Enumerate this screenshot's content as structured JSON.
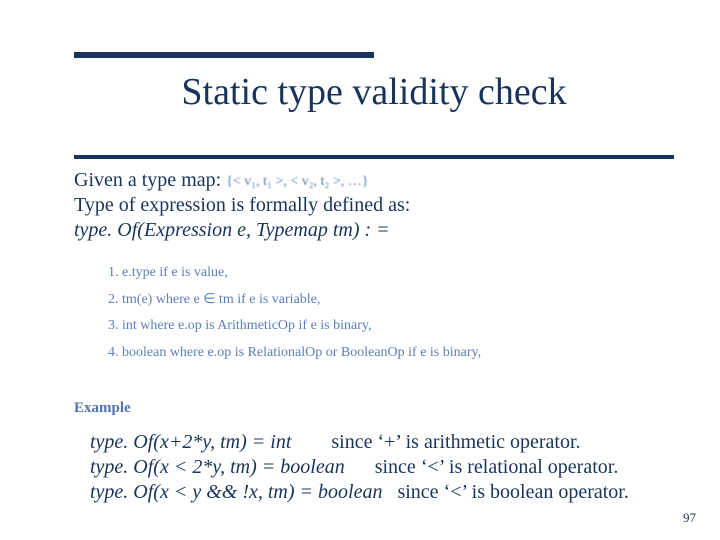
{
  "title": "Static type validity check",
  "intro": {
    "given_prefix": "Given a type map:",
    "typemap_set": "{< v₁, t₁ >, < v₂, t₂ >, …}",
    "line2": "Type of expression is formally defined as:",
    "line3": "type. Of(Expression e, Typemap tm)  : ="
  },
  "rules": {
    "r1": "1.  e.type if e is value,",
    "r2": "2.  tm(e) where e ∈ tm if e is variable,",
    "r3": "3.  int where e.op is ArithmeticOp if e is binary,",
    "r4": "4.  boolean where e.op is RelationalOp or BooleanOp if e is binary,"
  },
  "example_label": "Example",
  "examples": {
    "e1_left": "type. Of(x+2*y, tm) = int",
    "e1_right": "since ‘+’ is arithmetic operator.",
    "e2_left": "type. Of(x < 2*y, tm) = boolean",
    "e2_right": "since ‘<’ is relational operator.",
    "e3_left": "type. Of(x < y && !x, tm) = boolean",
    "e3_right": "since ‘<’ is boolean operator."
  },
  "page_number": "97"
}
